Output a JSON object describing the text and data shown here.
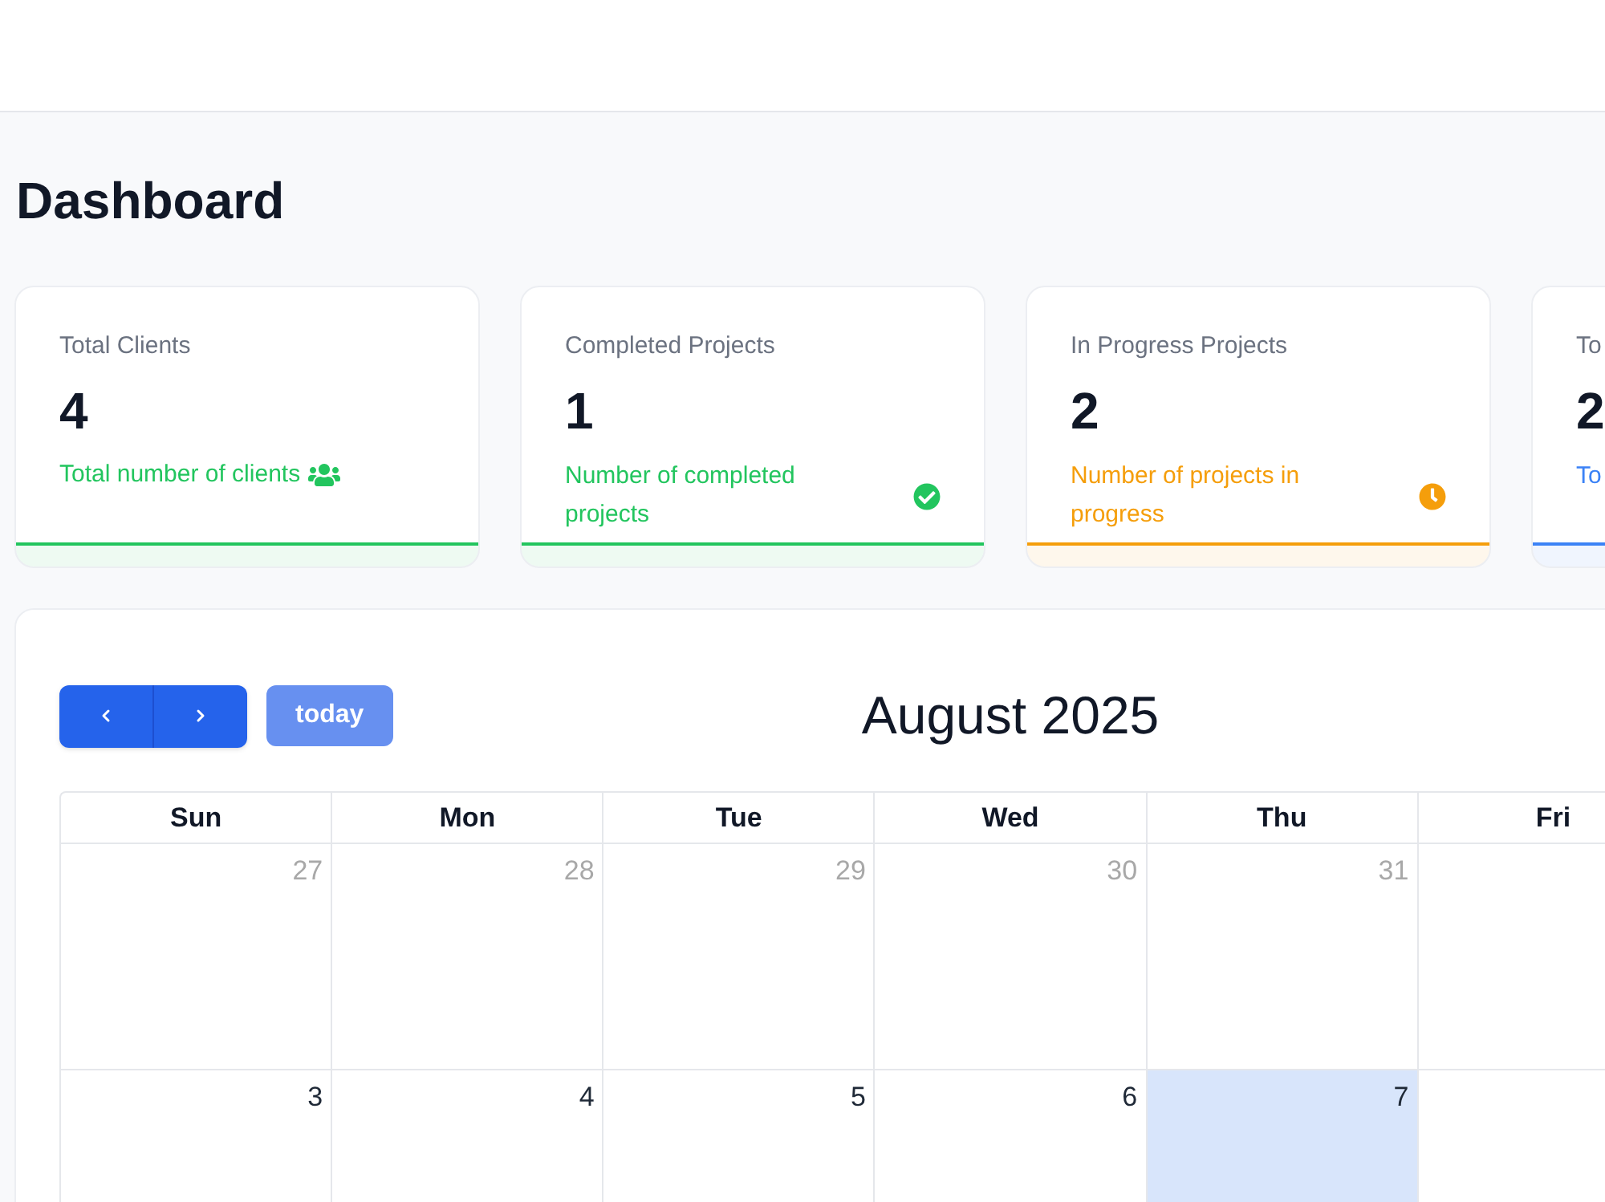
{
  "page_title": "Dashboard",
  "stat_cards": [
    {
      "title": "Total Clients",
      "value": "4",
      "description": "Total number of clients",
      "color": "#22c55e",
      "kind": "inline"
    },
    {
      "title": "Completed Projects",
      "value": "1",
      "description": "Number of completed projects",
      "color": "#22c55e",
      "kind": "aside"
    },
    {
      "title": "In Progress Projects",
      "value": "2",
      "description": "Number of projects in progress",
      "color": "#f59e0b",
      "kind": "aside"
    },
    {
      "title": "To",
      "value": "2",
      "description": "To",
      "color": "#3b82f6",
      "kind": "aside"
    }
  ],
  "calendar": {
    "title": "August 2025",
    "today_button": {
      "label": "today",
      "disabled": true
    },
    "weekdays": [
      "Sun",
      "Mon",
      "Tue",
      "Wed",
      "Thu",
      "Fri"
    ],
    "weeks": [
      {
        "days": [
          {
            "label": "27",
            "other_month": true,
            "today": false
          },
          {
            "label": "28",
            "other_month": true,
            "today": false
          },
          {
            "label": "29",
            "other_month": true,
            "today": false
          },
          {
            "label": "30",
            "other_month": true,
            "today": false
          },
          {
            "label": "31",
            "other_month": true,
            "today": false
          }
        ]
      },
      {
        "days": [
          {
            "label": "3",
            "other_month": false,
            "today": false
          },
          {
            "label": "4",
            "other_month": false,
            "today": false
          },
          {
            "label": "5",
            "other_month": false,
            "today": false
          },
          {
            "label": "6",
            "other_month": false,
            "today": false
          },
          {
            "label": "7",
            "other_month": false,
            "today": true
          }
        ]
      }
    ]
  }
}
